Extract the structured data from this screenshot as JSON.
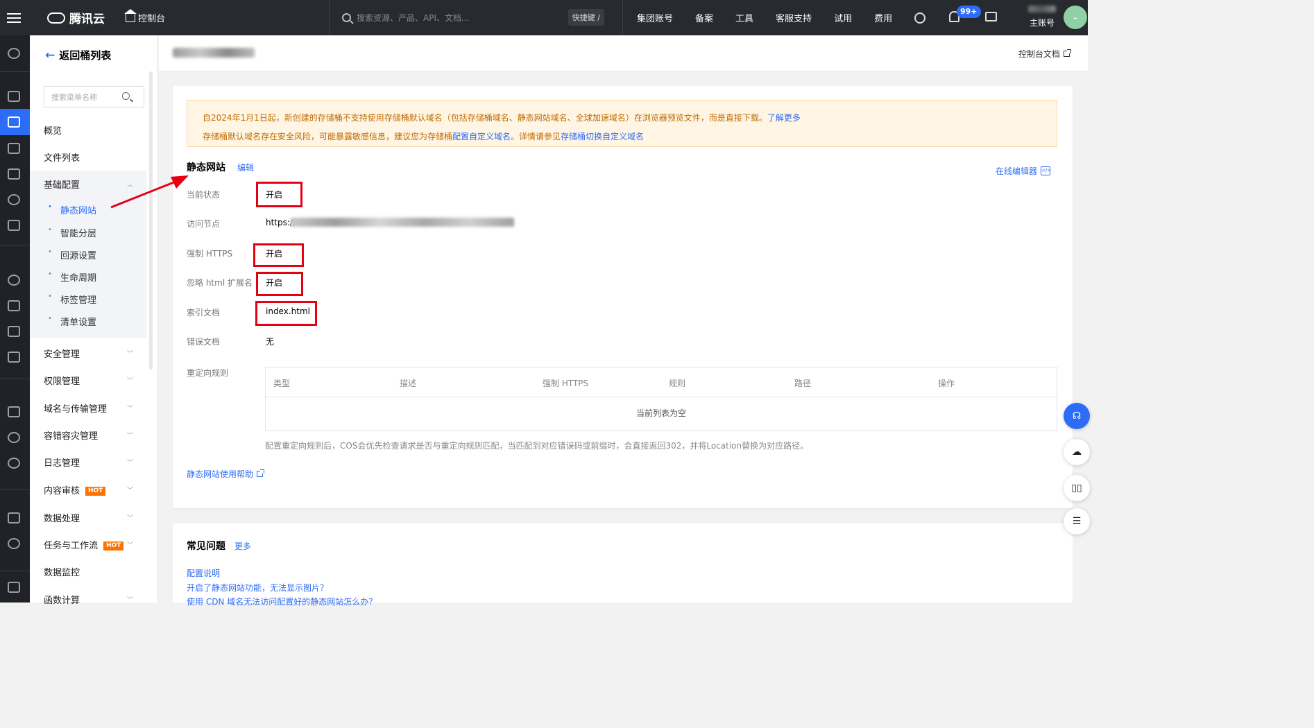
{
  "topbar": {
    "brand": "腾讯云",
    "console": "控制台",
    "search_placeholder": "搜索资源、产品、API、文档...",
    "shortcut": "快捷键 /",
    "menu": [
      "集团账号",
      "备案",
      "工具",
      "客服支持",
      "试用",
      "费用"
    ],
    "notification_badge": "99+",
    "account_label": "主账号",
    "avatar_initial": "-"
  },
  "sidebar": {
    "back_label": "返回桶列表",
    "search_placeholder": "搜索菜单名称",
    "items": [
      "概览",
      "文件列表"
    ],
    "group": "基础配置",
    "group_items": [
      "静态网站",
      "智能分层",
      "回源设置",
      "生命周期",
      "标签管理",
      "清单设置"
    ],
    "more_items": [
      {
        "label": "安全管理",
        "hot": ""
      },
      {
        "label": "权限管理",
        "hot": ""
      },
      {
        "label": "域名与传输管理",
        "hot": ""
      },
      {
        "label": "容错容灾管理",
        "hot": ""
      },
      {
        "label": "日志管理",
        "hot": ""
      },
      {
        "label": "内容审核",
        "hot": "HOT"
      },
      {
        "label": "数据处理",
        "hot": ""
      },
      {
        "label": "任务与工作流",
        "hot": "HOT"
      },
      {
        "label": "数据监控",
        "hot": ""
      },
      {
        "label": "函数计算",
        "hot": ""
      }
    ]
  },
  "header": {
    "doc_link": "控制台文档"
  },
  "notice": {
    "line1": "自2024年1月1日起，新创建的存储桶不支持使用存储桶默认域名（包括存储桶域名、静态网站域名、全球加速域名）在浏览器预览文件，而是直接下载。",
    "line1_link": "了解更多",
    "line2_a": "存储桶默认域名存在安全风险，可能暴露敏感信息，建议您为存储桶",
    "line2_link1": "配置自定义域名",
    "line2_b": "。详情请参见",
    "line2_link2": "存储桶切换自定义域名"
  },
  "static_site": {
    "title": "静态网站",
    "edit": "编辑",
    "online_editor": "在线编辑器",
    "fields": {
      "status_label": "当前状态",
      "status_value": "开启",
      "endpoint_label": "访问节点",
      "endpoint_value": "https://",
      "https_label": "强制 HTTPS",
      "https_value": "开启",
      "ignore_html_label": "忽略 html 扩展名",
      "ignore_html_value": "开启",
      "index_label": "索引文档",
      "index_value": "index.html",
      "error_label": "错误文档",
      "error_value": "无",
      "redirect_label": "重定向规则"
    },
    "table_headers": [
      "类型",
      "描述",
      "强制 HTTPS",
      "规则",
      "路径",
      "操作"
    ],
    "empty_text": "当前列表为空",
    "tip": "配置重定向规则后，COS会优先检查请求是否与重定向规则匹配，当匹配到对应错误码或前缀时，会直接返回302，并将Location替换为对应路径。",
    "help_link": "静态网站使用帮助"
  },
  "faq": {
    "title": "常见问题",
    "more": "更多",
    "items": [
      "配置说明",
      "开启了静态网站功能，无法显示图片？",
      "使用 CDN 域名无法访问配置好的静态网站怎么办？"
    ]
  },
  "colors": {
    "accent": "#2d6cf6",
    "topbar": "#272a2f",
    "annotation_red": "#e60012",
    "hot": "#ff7200"
  }
}
